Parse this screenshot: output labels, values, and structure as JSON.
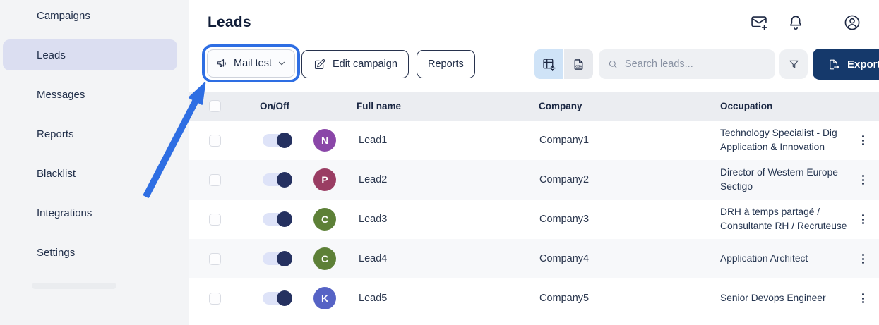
{
  "app": {
    "accent_blue": "#2e6ee3",
    "navy": "#15396b"
  },
  "sidebar": {
    "items": [
      {
        "label": "Campaigns",
        "icon": "megaphone-icon",
        "active": false
      },
      {
        "label": "Leads",
        "icon": "list-search-icon",
        "active": true
      },
      {
        "label": "Messages",
        "icon": "message-icon",
        "active": false
      },
      {
        "label": "Reports",
        "icon": "chart-icon",
        "active": false
      },
      {
        "label": "Blacklist",
        "icon": "user-block-icon",
        "active": false
      },
      {
        "label": "Integrations",
        "icon": "puzzle-icon",
        "active": false
      },
      {
        "label": "Settings",
        "icon": "sliders-icon",
        "active": false
      }
    ]
  },
  "header": {
    "title": "Leads",
    "icons": [
      "mail-plus-icon",
      "bell-icon",
      "user-circle-icon"
    ]
  },
  "toolbar": {
    "campaign_selector": {
      "label": "Mail test",
      "icon": "megaphone-icon",
      "highlighted": true
    },
    "edit_campaign_label": "Edit campaign",
    "reports_label": "Reports",
    "search_placeholder": "Search leads...",
    "export_label": "Export data",
    "view_buttons": [
      {
        "icon": "table-settings-icon",
        "active": true
      },
      {
        "icon": "csv-file-icon",
        "active": false
      }
    ]
  },
  "table": {
    "columns": [
      "On/Off",
      "Full name",
      "Company",
      "Occupation"
    ],
    "rows": [
      {
        "initial": "N",
        "avatar_color": "#8a46a8",
        "name": "Lead1",
        "company": "Company1",
        "occupation_line1": "Technology Specialist - Dig",
        "occupation_line2": "Application & Innovation",
        "enabled": true
      },
      {
        "initial": "P",
        "avatar_color": "#9a3d63",
        "name": "Lead2",
        "company": "Company2",
        "occupation_line1": "Director of Western Europe",
        "occupation_line2": "Sectigo",
        "enabled": true
      },
      {
        "initial": "C",
        "avatar_color": "#5d8037",
        "name": "Lead3",
        "company": "Company3",
        "occupation_line1": "DRH à temps partagé /",
        "occupation_line2": "Consultante RH / Recruteuse",
        "enabled": true
      },
      {
        "initial": "C",
        "avatar_color": "#5d8037",
        "name": "Lead4",
        "company": "Company4",
        "occupation_line1": "Application Architect",
        "occupation_line2": "",
        "enabled": true
      },
      {
        "initial": "K",
        "avatar_color": "#5663c5",
        "name": "Lead5",
        "company": "Company5",
        "occupation_line1": "Senior Devops Engineer",
        "occupation_line2": "",
        "enabled": true
      }
    ]
  },
  "annotation": {
    "type": "arrow-and-ring-highlight",
    "color": "#2e6ee3",
    "target": "Mail test campaign selector"
  }
}
